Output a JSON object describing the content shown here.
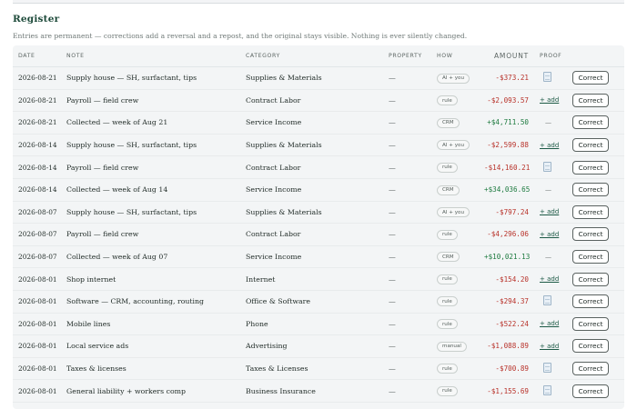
{
  "register": {
    "title": "Register",
    "subtitle": "Entries are permanent — corrections add a reversal and a repost, and the original stays visible. Nothing is ever silently changed."
  },
  "columns": {
    "date": "DATE",
    "note": "NOTE",
    "category": "CATEGORY",
    "property": "PROPERTY",
    "how": "HOW",
    "amount": "AMOUNT",
    "proof": "PROOF"
  },
  "action_label": "Correct",
  "rows": [
    {
      "date": "2026-08-21",
      "note": "Supply house — SH, surfactant, tips",
      "category": "Supplies & Materials",
      "property": "—",
      "how": "AI + you",
      "amount": "-$373.21",
      "sign": "neg",
      "proof": "doc"
    },
    {
      "date": "2026-08-21",
      "note": "Payroll — field crew",
      "category": "Contract Labor",
      "property": "—",
      "how": "rule",
      "amount": "-$2,093.57",
      "sign": "neg",
      "proof": "+ add"
    },
    {
      "date": "2026-08-21",
      "note": "Collected — week of Aug 21",
      "category": "Service Income",
      "property": "—",
      "how": "CRM",
      "amount": "+$4,711.50",
      "sign": "pos",
      "proof": "—"
    },
    {
      "date": "2026-08-14",
      "note": "Supply house — SH, surfactant, tips",
      "category": "Supplies & Materials",
      "property": "—",
      "how": "AI + you",
      "amount": "-$2,599.88",
      "sign": "neg",
      "proof": "+ add"
    },
    {
      "date": "2026-08-14",
      "note": "Payroll — field crew",
      "category": "Contract Labor",
      "property": "—",
      "how": "rule",
      "amount": "-$14,160.21",
      "sign": "neg",
      "proof": "doc"
    },
    {
      "date": "2026-08-14",
      "note": "Collected — week of Aug 14",
      "category": "Service Income",
      "property": "—",
      "how": "CRM",
      "amount": "+$34,036.65",
      "sign": "pos",
      "proof": "—"
    },
    {
      "date": "2026-08-07",
      "note": "Supply house — SH, surfactant, tips",
      "category": "Supplies & Materials",
      "property": "—",
      "how": "AI + you",
      "amount": "-$797.24",
      "sign": "neg",
      "proof": "+ add"
    },
    {
      "date": "2026-08-07",
      "note": "Payroll — field crew",
      "category": "Contract Labor",
      "property": "—",
      "how": "rule",
      "amount": "-$4,296.06",
      "sign": "neg",
      "proof": "+ add"
    },
    {
      "date": "2026-08-07",
      "note": "Collected — week of Aug 07",
      "category": "Service Income",
      "property": "—",
      "how": "CRM",
      "amount": "+$10,021.13",
      "sign": "pos",
      "proof": "—"
    },
    {
      "date": "2026-08-01",
      "note": "Shop internet",
      "category": "Internet",
      "property": "—",
      "how": "rule",
      "amount": "-$154.20",
      "sign": "neg",
      "proof": "+ add"
    },
    {
      "date": "2026-08-01",
      "note": "Software — CRM, accounting, routing",
      "category": "Office & Software",
      "property": "—",
      "how": "rule",
      "amount": "-$294.37",
      "sign": "neg",
      "proof": "doc"
    },
    {
      "date": "2026-08-01",
      "note": "Mobile lines",
      "category": "Phone",
      "property": "—",
      "how": "rule",
      "amount": "-$522.24",
      "sign": "neg",
      "proof": "+ add"
    },
    {
      "date": "2026-08-01",
      "note": "Local service ads",
      "category": "Advertising",
      "property": "—",
      "how": "manual",
      "amount": "-$1,088.89",
      "sign": "neg",
      "proof": "+ add"
    },
    {
      "date": "2026-08-01",
      "note": "Taxes & licenses",
      "category": "Taxes & Licenses",
      "property": "—",
      "how": "rule",
      "amount": "-$700.89",
      "sign": "neg",
      "proof": "doc"
    },
    {
      "date": "2026-08-01",
      "note": "General liability + workers comp",
      "category": "Business Insurance",
      "property": "—",
      "how": "rule",
      "amount": "-$1,155.69",
      "sign": "neg",
      "proof": "doc"
    }
  ],
  "colors": {
    "heading": "#1d4a3a",
    "negative": "#b8322a",
    "positive": "#1d7a3f",
    "link": "#1d5a46",
    "table_bg": "#f3f5f6"
  },
  "icons": {
    "proof_doc": "document-icon"
  }
}
